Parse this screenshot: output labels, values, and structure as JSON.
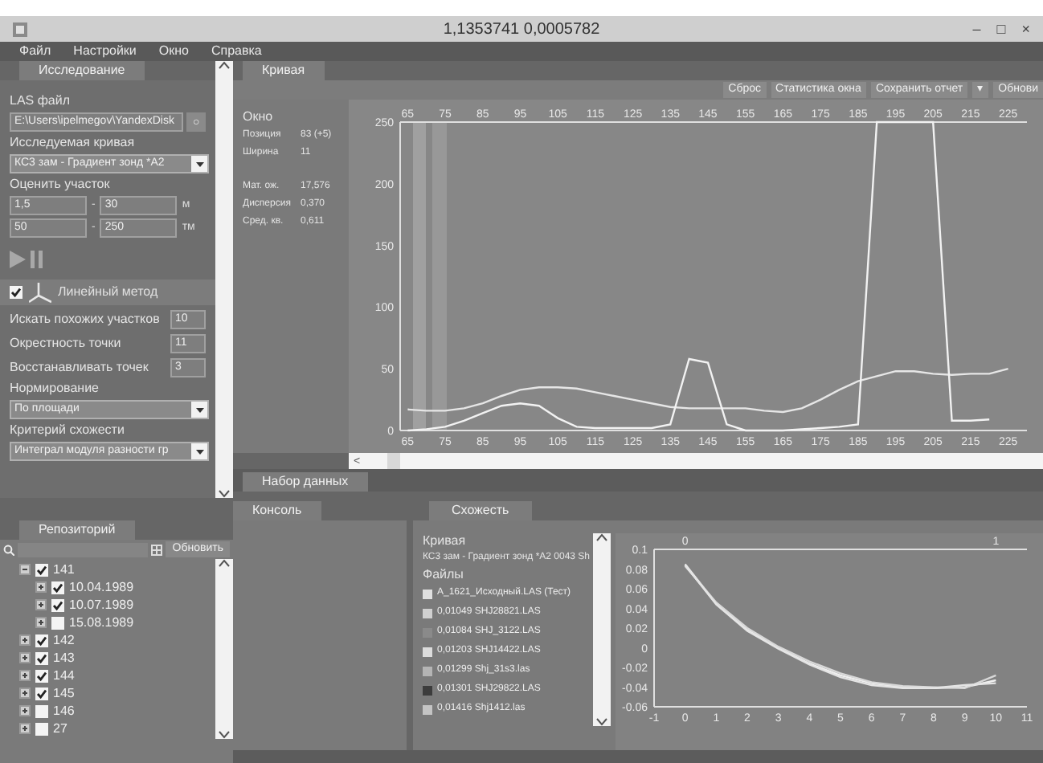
{
  "window": {
    "title": "1,1353741 0,0005782",
    "controls": [
      "–",
      "□",
      "×"
    ]
  },
  "menu": [
    "Файл",
    "Настройки",
    "Окно",
    "Справка"
  ],
  "left_panel": {
    "tab": {
      "label": "Исследование",
      "selected": true
    },
    "las_label": "LAS файл",
    "las_path": "E:\\Users\\ipelmegov\\YandexDisk",
    "browse": "○",
    "curve_label": "Исследуемая кривая",
    "curve_value": "КС3 зам - Градиент зонд *A2",
    "range_label": "Оценить участок",
    "ranges": [
      {
        "from": "1,5",
        "dash": "-",
        "to": "30",
        "unit": "м"
      },
      {
        "from": "50",
        "dash": "-",
        "to": "250",
        "unit": "тм"
      }
    ],
    "method": {
      "checked": true,
      "label": "Линейный метод"
    },
    "params": [
      {
        "label": "Искать похожих участков",
        "value": "10"
      },
      {
        "label": "Окрестность точки",
        "value": "11"
      },
      {
        "label": "Восстанавливать точек",
        "value": "3"
      }
    ],
    "norm_label": "Нормирование",
    "norm_value": "По площади",
    "criterion_label": "Критерий схожести",
    "criterion_value": "Интеграл модуля разности гр"
  },
  "repository": {
    "tab": {
      "label": "Репозиторий",
      "selected": true
    },
    "refresh": "Обновить",
    "tree": [
      {
        "label": "141",
        "checked": true,
        "expanded": true,
        "children": [
          {
            "label": "10.04.1989",
            "checked": true,
            "expanded": false
          },
          {
            "label": "10.07.1989",
            "checked": true,
            "expanded": false
          },
          {
            "label": "15.08.1989",
            "checked": false,
            "expanded": false
          }
        ]
      },
      {
        "label": "142",
        "checked": true,
        "expanded": false
      },
      {
        "label": "143",
        "checked": true,
        "expanded": false
      },
      {
        "label": "144",
        "checked": true,
        "expanded": false
      },
      {
        "label": "145",
        "checked": true,
        "expanded": false
      },
      {
        "label": "146",
        "checked": false,
        "expanded": false
      },
      {
        "label": "27",
        "checked": false,
        "expanded": false
      }
    ]
  },
  "curve_tab": {
    "label": "Кривая",
    "selected": true
  },
  "toolbar": [
    "Сброс",
    "Статистика окна",
    "Сохранить отчет",
    "▾",
    "Обнови"
  ],
  "stats": {
    "title": "Окно",
    "rows": [
      {
        "label": "Позиция",
        "value": "83 (+5)"
      },
      {
        "label": "Ширина",
        "value": "11"
      }
    ],
    "rows2": [
      {
        "label": "Мат. ож.",
        "value": "17,576"
      },
      {
        "label": "Дисперсия",
        "value": "0,370"
      },
      {
        "label": "Сред. кв.",
        "value": "0,611"
      }
    ]
  },
  "main_chart": {
    "chart_data": {
      "type": "line",
      "x": [
        65,
        70,
        75,
        80,
        85,
        90,
        95,
        100,
        105,
        110,
        115,
        120,
        125,
        130,
        135,
        140,
        145,
        150,
        155,
        160,
        165,
        170,
        175,
        180,
        185,
        190,
        195,
        200,
        205,
        210,
        215,
        220,
        225
      ],
      "series": [
        {
          "color": "#e6e6e6",
          "values": [
            17,
            16,
            16,
            18,
            22,
            28,
            33,
            35,
            35,
            34,
            31,
            28,
            25,
            22,
            19,
            18,
            18,
            18,
            18,
            16,
            15,
            18,
            25,
            33,
            40,
            44,
            48,
            48,
            46,
            45,
            46,
            46,
            50
          ]
        },
        {
          "color": "#f2f2f2",
          "values": [
            0,
            1,
            3,
            8,
            14,
            20,
            22,
            20,
            10,
            3,
            2,
            2,
            2,
            2,
            5,
            58,
            55,
            5,
            0,
            0,
            0,
            1,
            2,
            3,
            5,
            250,
            250,
            250,
            250,
            8,
            8,
            9,
            null
          ]
        }
      ],
      "xlim": [
        63,
        230
      ],
      "ylim": [
        0,
        250
      ],
      "xticks": [
        {
          "value": 65,
          "label": "65"
        },
        {
          "value": 75,
          "label": "75"
        },
        {
          "value": 85,
          "label": "85"
        },
        {
          "value": 95,
          "label": "95"
        },
        {
          "value": 105,
          "label": "105"
        },
        {
          "value": 115,
          "label": "115"
        },
        {
          "value": 125,
          "label": "125"
        },
        {
          "value": 135,
          "label": "135"
        },
        {
          "value": 145,
          "label": "145"
        },
        {
          "value": 155,
          "label": "155"
        },
        {
          "value": 165,
          "label": "165"
        },
        {
          "value": 175,
          "label": "175"
        },
        {
          "value": 185,
          "label": "185"
        },
        {
          "value": 195,
          "label": "195"
        },
        {
          "value": 205,
          "label": "205"
        },
        {
          "value": 215,
          "label": "215"
        },
        {
          "value": 225,
          "label": "225"
        }
      ],
      "yticks": [
        0,
        50,
        100,
        150,
        200,
        250
      ]
    },
    "top_xticks": [
      "65",
      "75",
      "85",
      "95",
      "105",
      "115",
      "125",
      "135",
      "145",
      "155",
      "165",
      "175",
      "185",
      "195",
      "205",
      "215",
      "225"
    ]
  },
  "hscroll_arrow": "<",
  "data_tab": {
    "label": "Набор данных",
    "selected": true
  },
  "console_tab": {
    "label": "Консоль",
    "selected": true
  },
  "similarity": {
    "tab": {
      "label": "Схожесть",
      "selected": true
    },
    "curve_label": "Кривая",
    "curve_value": "КС3 зам - Градиент зонд *A2 0043 Sh",
    "files_label": "Файлы",
    "files": [
      {
        "label": "A_1621_Исходный.LAS (Тест)",
        "color": "#e0e0e0"
      },
      {
        "label": "0,01049 SHJ28821.LAS",
        "color": "#d0d0d0"
      },
      {
        "label": "0,01084 SHJ_3122.LAS",
        "color": "#8a8a8a"
      },
      {
        "label": "0,01203 SHJ14422.LAS",
        "color": "#dcdcdc"
      },
      {
        "label": "0,01299 Shj_31s3.las",
        "color": "#b4b4b4"
      },
      {
        "label": "0,01301 SHJ29822.LAS",
        "color": "#3c3c3c"
      },
      {
        "label": "0,01416 Shj1412.las",
        "color": "#c4c4c4"
      }
    ],
    "chart_data": {
      "type": "line",
      "x": [
        0,
        1,
        2,
        3,
        4,
        5,
        6,
        7,
        8,
        9,
        10
      ],
      "series": [
        {
          "color": "#f0f0f0",
          "values": [
            0.085,
            0.045,
            0.018,
            0.0,
            -0.016,
            -0.028,
            -0.036,
            -0.04,
            -0.041,
            -0.04,
            -0.033
          ]
        },
        {
          "color": "#d8d8d8",
          "values": [
            0.083,
            0.046,
            0.02,
            0.001,
            -0.014,
            -0.026,
            -0.035,
            -0.039,
            -0.04,
            -0.041,
            -0.028
          ]
        },
        {
          "color": "#e4e4e4",
          "values": [
            0.084,
            0.044,
            0.017,
            -0.001,
            -0.017,
            -0.03,
            -0.038,
            -0.041,
            -0.041,
            -0.038,
            -0.036
          ]
        }
      ],
      "xlim": [
        -1,
        11
      ],
      "ylim": [
        -0.06,
        0.1
      ],
      "xticks": [
        -1,
        0,
        1,
        2,
        3,
        4,
        5,
        6,
        7,
        8,
        9,
        10,
        11
      ],
      "yticks": [
        {
          "value": -0.06,
          "label": "-0.06"
        },
        {
          "value": -0.04,
          "label": "-0.04"
        },
        {
          "value": -0.02,
          "label": "-0.02"
        },
        {
          "value": 0,
          "label": "0"
        },
        {
          "value": 0.02,
          "label": "0.02"
        },
        {
          "value": 0.04,
          "label": "0.04"
        },
        {
          "value": 0.06,
          "label": "0.06"
        },
        {
          "value": 0.08,
          "label": "0.08"
        },
        {
          "value": 0.1,
          "label": "0.1"
        }
      ]
    },
    "chart_top_labels": [
      "0",
      "1"
    ]
  }
}
